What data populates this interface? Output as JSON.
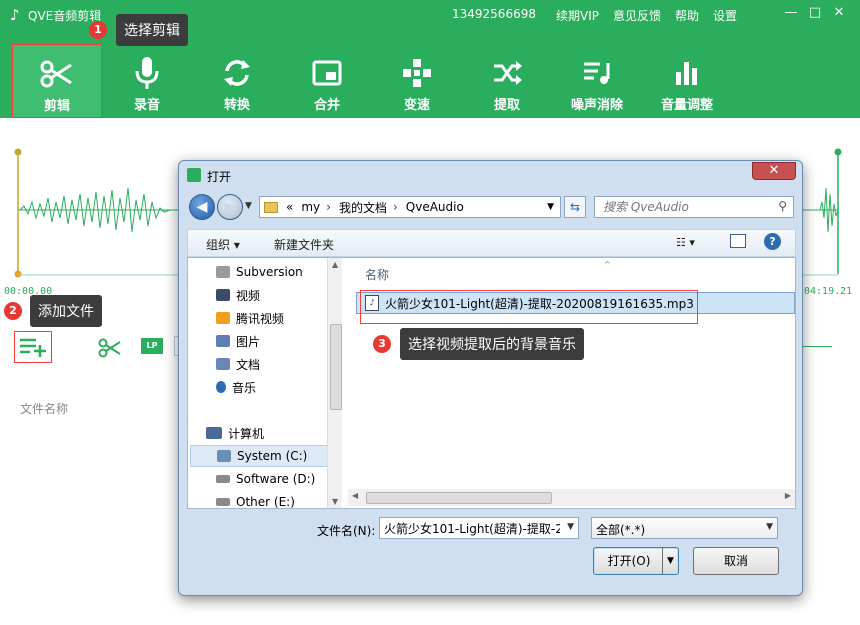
{
  "app": {
    "title": "QVE音频剪辑",
    "phone": "13492566698",
    "links": [
      "续期VIP",
      "意见反馈",
      "帮助",
      "设置"
    ],
    "window_controls": {
      "minimize": "—",
      "maximize": "□",
      "close": "✕"
    }
  },
  "toolbar": {
    "items": [
      {
        "label": "剪辑",
        "icon": "scissors-icon",
        "active": true
      },
      {
        "label": "录音",
        "icon": "microphone-icon",
        "active": false
      },
      {
        "label": "转换",
        "icon": "convert-icon",
        "active": false
      },
      {
        "label": "合并",
        "icon": "merge-icon",
        "active": false
      },
      {
        "label": "变速",
        "icon": "speed-icon",
        "active": false
      },
      {
        "label": "提取",
        "icon": "extract-icon",
        "active": false
      },
      {
        "label": "噪声消除",
        "icon": "noise-removal-icon",
        "active": false
      },
      {
        "label": "音量调整",
        "icon": "volume-bars-icon",
        "active": false
      }
    ]
  },
  "callouts": [
    {
      "num": "1",
      "text": "选择剪辑"
    },
    {
      "num": "2",
      "text": "添加文件"
    },
    {
      "num": "3",
      "text": "选择视频提取后的背景音乐"
    }
  ],
  "waveform": {
    "start_time": "00:00.00",
    "end_time": "04:19.21"
  },
  "controls": {
    "lp_label": "LP"
  },
  "file_list": {
    "column_header": "文件名称"
  },
  "dialog": {
    "title": "打开",
    "close": "✕",
    "path": [
      "«",
      "my",
      "›",
      "我的文档",
      "›",
      "QveAudio"
    ],
    "search_placeholder": "搜索 QveAudio",
    "organize": "组织 ▾",
    "new_folder": "新建文件夹",
    "nav": [
      {
        "label": "Subversion",
        "color": "#9b9b9b"
      },
      {
        "label": "视频",
        "color": "#3b4a66"
      },
      {
        "label": "腾讯视频",
        "color": "#f0a020"
      },
      {
        "label": "图片",
        "color": "#5a7fb0"
      },
      {
        "label": "文档",
        "color": "#6a86b5"
      },
      {
        "label": "音乐",
        "color": "#2d6bb3"
      },
      {
        "label": "计算机",
        "color": "#4a6a9a"
      },
      {
        "label": "System (C:)",
        "color": "#6b8fb8"
      },
      {
        "label": "Software (D:)",
        "color": "#8a8a8a"
      },
      {
        "label": "Other (E:)",
        "color": "#8a8a8a"
      }
    ],
    "column_name": "名称",
    "file": "火箭少女101-Light(超清)-提取-20200819161635.mp3",
    "filename_label": "文件名(N):",
    "filename_value": "火箭少女101-Light(超清)-提取-2",
    "filetype": "全部(*.*)",
    "open_button": "打开(O)",
    "cancel_button": "取消"
  }
}
